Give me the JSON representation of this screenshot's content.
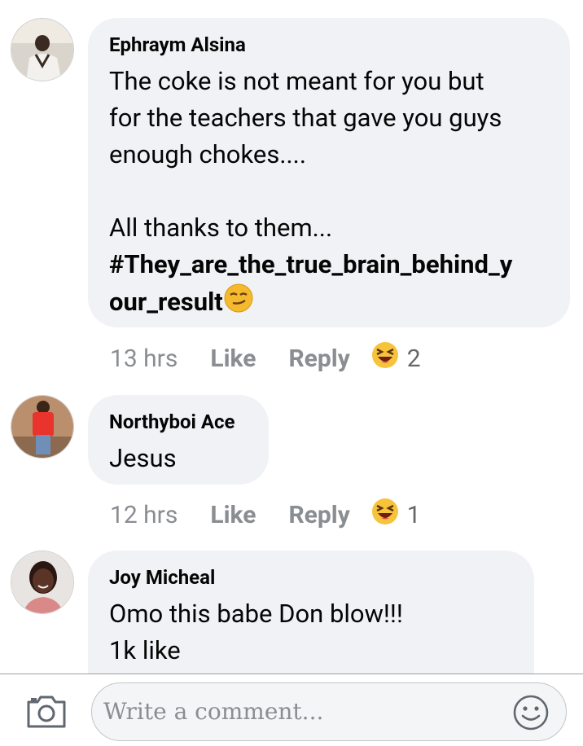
{
  "comments": [
    {
      "author": "Ephraym Alsina",
      "text": "The coke is not meant for you but\nfor the teachers that gave you guys\nenough chokes....\n\nAll thanks to them...",
      "hashtag_line1": "#They_are_the_true_brain_behind_y",
      "hashtag_line2": "our_result",
      "inline_emoji": "smirking-face",
      "time": "13 hrs",
      "like": "Like",
      "reply": "Reply",
      "reaction": "laughing",
      "reaction_count": "2"
    },
    {
      "author": "Northyboi Ace",
      "text": "Jesus",
      "time": "12 hrs",
      "like": "Like",
      "reply": "Reply",
      "reaction": "laughing",
      "reaction_count": "1"
    },
    {
      "author": "Joy Micheal",
      "text": "Omo this babe Don blow!!!\n1k like"
    }
  ],
  "composer": {
    "placeholder": "Write a comment...",
    "camera_icon": "camera-icon",
    "emoji_icon": "smile-icon"
  }
}
